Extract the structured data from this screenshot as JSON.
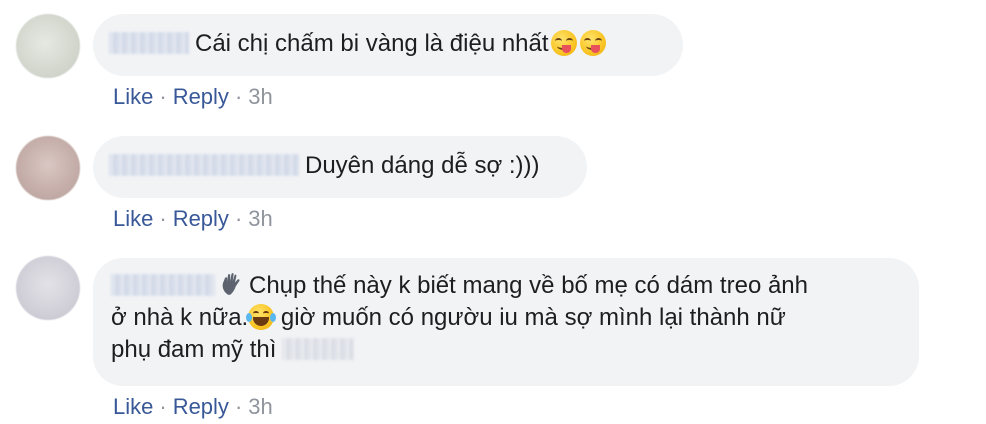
{
  "comments": [
    {
      "text": "Cái chị chấm bi vàng là điệu nhất",
      "emoji": [
        "yum-face-icon",
        "yum-face-icon"
      ],
      "actions": {
        "like": "Like",
        "reply": "Reply",
        "time": "3h",
        "sep": "·"
      }
    },
    {
      "text": "Duyên dáng dễ sợ :)))",
      "actions": {
        "like": "Like",
        "reply": "Reply",
        "time": "3h",
        "sep": "·"
      }
    },
    {
      "line1": "Chụp thế này k biết mang về bố mẹ có dám treo ảnh",
      "line2a": "ở nhà k nữa.",
      "line2b": " giờ muốn có ngườu iu mà sợ mình lại thành nữ",
      "line3": "phụ đam mỹ thì",
      "actions": {
        "like": "Like",
        "reply": "Reply",
        "time": "3h",
        "sep": "·"
      }
    }
  ],
  "colors": {
    "bubble": "#f2f3f5",
    "link": "#385898",
    "meta": "#90949c",
    "text": "#1c1e21"
  }
}
